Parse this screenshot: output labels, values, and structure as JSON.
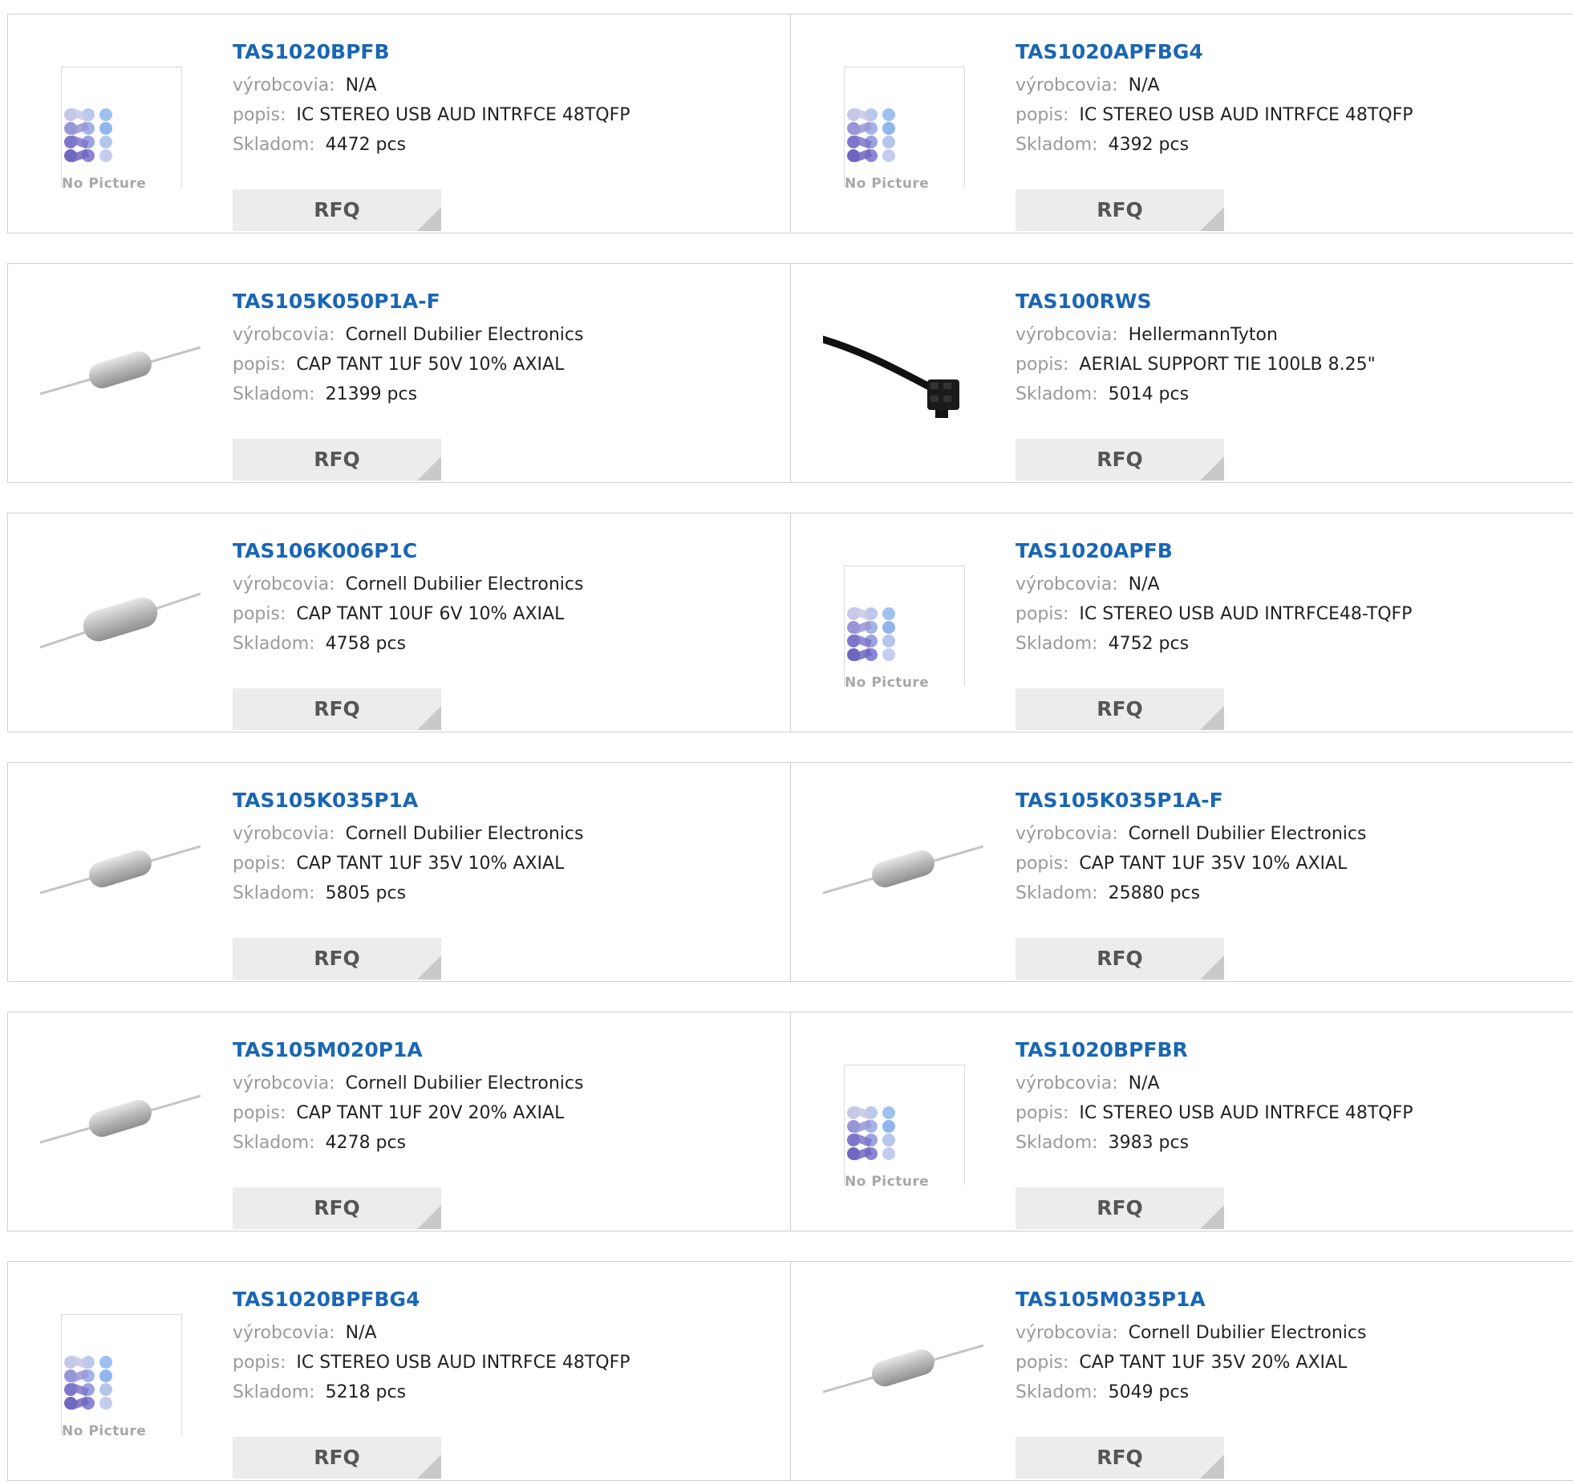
{
  "labels": {
    "manufacturer": "výrobcovia:",
    "description": "popis:",
    "stock": "Skladom:",
    "rfq": "RFQ",
    "no_picture": "No Picture"
  },
  "products": [
    {
      "pn": "TAS1020BPFB",
      "manufacturer": "N/A",
      "description": "IC STEREO USB AUD INTRFCE 48TQFP",
      "stock": "4472 pcs",
      "image": "no-picture"
    },
    {
      "pn": "TAS1020APFBG4",
      "manufacturer": "N/A",
      "description": "IC STEREO USB AUD INTRFCE 48TQFP",
      "stock": "4392 pcs",
      "image": "no-picture"
    },
    {
      "pn": "TAS105K050P1A-F",
      "manufacturer": "Cornell Dubilier Electronics",
      "description": "CAP TANT 1UF 50V 10% AXIAL",
      "stock": "21399 pcs",
      "image": "axial-capacitor"
    },
    {
      "pn": "TAS100RWS",
      "manufacturer": "HellermannTyton",
      "description": "AERIAL SUPPORT TIE 100LB 8.25\"",
      "stock": "5014 pcs",
      "image": "cable-tie"
    },
    {
      "pn": "TAS106K006P1C",
      "manufacturer": "Cornell Dubilier Electronics",
      "description": "CAP TANT 10UF 6V 10% AXIAL",
      "stock": "4758 pcs",
      "image": "axial-capacitor-large"
    },
    {
      "pn": "TAS1020APFB",
      "manufacturer": "N/A",
      "description": "IC STEREO USB AUD INTRFCE48-TQFP",
      "stock": "4752 pcs",
      "image": "no-picture"
    },
    {
      "pn": "TAS105K035P1A",
      "manufacturer": "Cornell Dubilier Electronics",
      "description": "CAP TANT 1UF 35V 10% AXIAL",
      "stock": "5805 pcs",
      "image": "axial-capacitor"
    },
    {
      "pn": "TAS105K035P1A-F",
      "manufacturer": "Cornell Dubilier Electronics",
      "description": "CAP TANT 1UF 35V 10% AXIAL",
      "stock": "25880 pcs",
      "image": "axial-capacitor"
    },
    {
      "pn": "TAS105M020P1A",
      "manufacturer": "Cornell Dubilier Electronics",
      "description": "CAP TANT 1UF 20V 20% AXIAL",
      "stock": "4278 pcs",
      "image": "axial-capacitor"
    },
    {
      "pn": "TAS1020BPFBR",
      "manufacturer": "N/A",
      "description": "IC STEREO USB AUD INTRFCE 48TQFP",
      "stock": "3983 pcs",
      "image": "no-picture"
    },
    {
      "pn": "TAS1020BPFBG4",
      "manufacturer": "N/A",
      "description": "IC STEREO USB AUD INTRFCE 48TQFP",
      "stock": "5218 pcs",
      "image": "no-picture"
    },
    {
      "pn": "TAS105M035P1A",
      "manufacturer": "Cornell Dubilier Electronics",
      "description": "CAP TANT 1UF 35V 20% AXIAL",
      "stock": "5049 pcs",
      "image": "axial-capacitor"
    }
  ],
  "colors": {
    "link": "#1a66b3",
    "label": "#9a9a9a",
    "border": "#cfcfcf",
    "rfq_bg": "#ececec"
  }
}
